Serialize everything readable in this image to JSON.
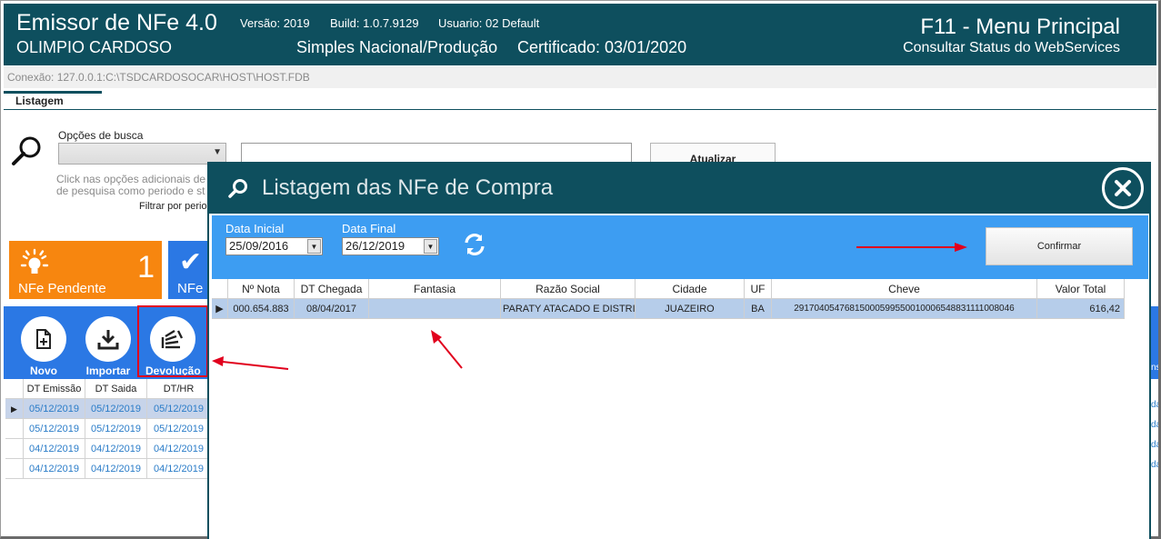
{
  "header": {
    "app_title": "Emissor de NFe 4.0",
    "company": "OLIMPIO CARDOSO",
    "version": "Versão: 2019",
    "build": "Build: 1.0.7.9129",
    "user": "Usuario: 02 Default",
    "regime": "Simples Nacional/Produção",
    "certificate": "Certificado: 03/01/2020",
    "menu_title": "F11 - Menu Principal",
    "ws_status": "Consultar Status do WebServices"
  },
  "connection": "Conexão: 127.0.0.1:C:\\TSDCARDOSOCAR\\HOST\\HOST.FDB",
  "tab": "Listagem",
  "search": {
    "options_label": "Opções de busca",
    "hint_line1": "Click nas opções adicionais de",
    "hint_line2": "de pesquisa como periodo e st",
    "filter_label": "Filtrar por perio",
    "refresh_label": "Atualizar"
  },
  "tiles": {
    "pending_label": "NFe Pendente",
    "pending_count": "1",
    "nfe_label": "NFe"
  },
  "toolbar": {
    "novo": "Novo",
    "importar": "Importar",
    "devolucao": "Devolução"
  },
  "back_grid": {
    "columns": [
      "DT Emissão",
      "DT Saida",
      "DT/HR"
    ],
    "rows": [
      [
        "05/12/2019",
        "05/12/2019",
        "05/12/2019"
      ],
      [
        "05/12/2019",
        "05/12/2019",
        "05/12/2019"
      ],
      [
        "04/12/2019",
        "04/12/2019",
        "04/12/2019"
      ],
      [
        "04/12/2019",
        "04/12/2019",
        "04/12/2019"
      ]
    ],
    "right_fragments": [
      "ns",
      "da",
      "da",
      "da",
      "da"
    ]
  },
  "modal": {
    "title": "Listagem das NFe de Compra",
    "data_inicial_label": "Data Inicial",
    "data_inicial": "25/09/2016",
    "data_final_label": "Data Final",
    "data_final": "26/12/2019",
    "confirm_label": "Confirmar",
    "columns": [
      "Nº Nota",
      "DT Chegada",
      "Fantasia",
      "Razão Social",
      "Cidade",
      "UF",
      "Cheve",
      "Valor Total"
    ],
    "rows": [
      {
        "nota": "000.654.883",
        "dt_chegada": "08/04/2017",
        "fantasia": "",
        "razao": "PARATY ATACADO E DISTRIB",
        "cidade": "JUAZEIRO",
        "uf": "BA",
        "chave": "29170405476815000599550010006548831111008046",
        "valor": "616,42"
      }
    ]
  },
  "colors": {
    "header_bg": "#0e4f5e",
    "tile_orange": "#f7860f",
    "blue": "#2b78e4",
    "filter_blue": "#3d9df2",
    "highlight_red": "#e1001d"
  }
}
